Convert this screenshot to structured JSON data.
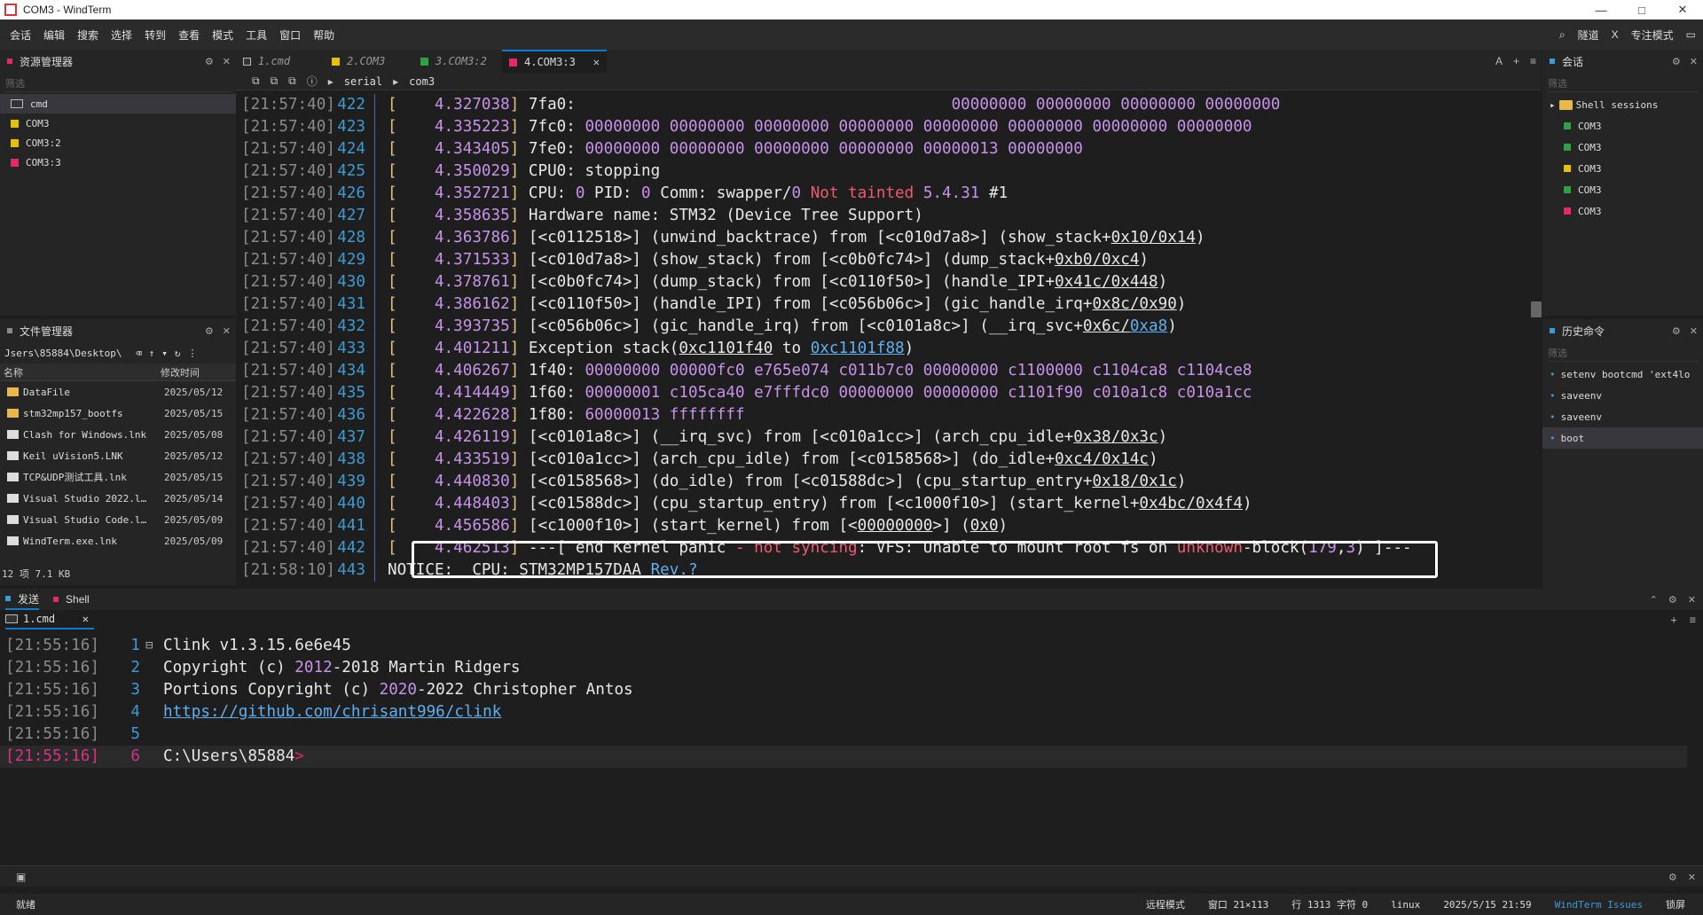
{
  "window": {
    "title": "COM3 - WindTerm",
    "controls": [
      "—",
      "□",
      "✕"
    ]
  },
  "menu": {
    "items": [
      "会话",
      "编辑",
      "搜索",
      "选择",
      "转到",
      "查看",
      "模式",
      "工具",
      "窗口",
      "帮助"
    ],
    "right": {
      "search": "⌕",
      "tunnel": "隧道",
      "x": "X",
      "focus_mode": "专注模式",
      "layout": "▭"
    }
  },
  "explorer": {
    "title": "资源管理器",
    "filter_placeholder": "筛选",
    "items": [
      {
        "label": "cmd",
        "color": ""
      },
      {
        "label": "COM3",
        "color": "#e5c100"
      },
      {
        "label": "COM3:2",
        "color": "#e5c100"
      },
      {
        "label": "COM3:3",
        "color": "#e5286c"
      }
    ]
  },
  "filemgr": {
    "title": "文件管理器",
    "path": "Jsers\\85884\\Desktop\\",
    "col_name": "名称",
    "col_modified": "修改时间",
    "files": [
      {
        "name": "DataFile",
        "date": "2025/05/12"
      },
      {
        "name": "stm32mp157_bootfs",
        "date": "2025/05/15"
      },
      {
        "name": "Clash for Windows.lnk",
        "date": "2025/05/08"
      },
      {
        "name": "Keil uVision5.LNK",
        "date": "2025/05/12"
      },
      {
        "name": "TCP&UDP测试工具.lnk",
        "date": "2025/05/15"
      },
      {
        "name": "Visual Studio 2022.l…",
        "date": "2025/05/14"
      },
      {
        "name": "Visual Studio Code.l…",
        "date": "2025/05/09"
      },
      {
        "name": "WindTerm.exe.lnk",
        "date": "2025/05/09"
      }
    ],
    "summary": "12 项 7.1 KB"
  },
  "tabs": [
    {
      "label": "1.cmd",
      "color": "#ffffff"
    },
    {
      "label": "2.COM3",
      "color": "#e5c100"
    },
    {
      "label": "3.COM3:2",
      "color": "#2ea043"
    },
    {
      "label": "4.COM3:3",
      "color": "#e5286c",
      "active": true,
      "close": "✕"
    }
  ],
  "breadcrumb": {
    "a": "serial",
    "b": "com3"
  },
  "terminal": {
    "lines": [
      {
        "ts": "[21:57:40]",
        "ln": "422",
        "html": "<span class='k-y'>[</span>    <span class='k-p'>4.327038</span><span class='k-y'>]</span> 7fa0:                                        <span class='k-p'>00000000 00000000 00000000 00000000</span>"
      },
      {
        "ts": "[21:57:40]",
        "ln": "423",
        "html": "<span class='k-y'>[</span>    <span class='k-p'>4.335223</span><span class='k-y'>]</span> 7fc0: <span class='k-p'>00000000 00000000 00000000 00000000 00000000 00000000 00000000 00000000</span>"
      },
      {
        "ts": "[21:57:40]",
        "ln": "424",
        "html": "<span class='k-y'>[</span>    <span class='k-p'>4.343405</span><span class='k-y'>]</span> 7fe0: <span class='k-p'>00000000 00000000 00000000 00000000 00000013 00000000</span>"
      },
      {
        "ts": "[21:57:40]",
        "ln": "425",
        "html": "<span class='k-y'>[</span>    <span class='k-p'>4.350029</span><span class='k-y'>]</span> CPU0: stopping"
      },
      {
        "ts": "[21:57:40]",
        "ln": "426",
        "html": "<span class='k-y'>[</span>    <span class='k-p'>4.352721</span><span class='k-y'>]</span> CPU: <span class='k-p'>0</span> PID: <span class='k-p'>0</span> Comm: swapper/<span class='k-p'>0</span> <span class='k-r'>Not tainted</span> <span class='k-p'>5.4.31</span> #1"
      },
      {
        "ts": "[21:57:40]",
        "ln": "427",
        "html": "<span class='k-y'>[</span>    <span class='k-p'>4.358635</span><span class='k-y'>]</span> Hardware name: STM32 (Device Tree Support)"
      },
      {
        "ts": "[21:57:40]",
        "ln": "428",
        "html": "<span class='k-y'>[</span>    <span class='k-p'>4.363786</span><span class='k-y'>]</span> [&lt;c0112518&gt;] (unwind_backtrace) from [&lt;c010d7a8&gt;] (show_stack+<span class='k-u'>0x10/0x14</span>)"
      },
      {
        "ts": "[21:57:40]",
        "ln": "429",
        "html": "<span class='k-y'>[</span>    <span class='k-p'>4.371533</span><span class='k-y'>]</span> [&lt;c010d7a8&gt;] (show_stack) from [&lt;c0b0fc74&gt;] (dump_stack+<span class='k-u'>0xb0/0xc4</span>)"
      },
      {
        "ts": "[21:57:40]",
        "ln": "430",
        "html": "<span class='k-y'>[</span>    <span class='k-p'>4.378761</span><span class='k-y'>]</span> [&lt;c0b0fc74&gt;] (dump_stack) from [&lt;c0110f50&gt;] (handle_IPI+<span class='k-u'>0x41c/0x448</span>)"
      },
      {
        "ts": "[21:57:40]",
        "ln": "431",
        "html": "<span class='k-y'>[</span>    <span class='k-p'>4.386162</span><span class='k-y'>]</span> [&lt;c0110f50&gt;] (handle_IPI) from [&lt;c056b06c&gt;] (gic_handle_irq+<span class='k-u'>0x8c/0x90</span>)"
      },
      {
        "ts": "[21:57:40]",
        "ln": "432",
        "html": "<span class='k-y'>[</span>    <span class='k-p'>4.393735</span><span class='k-y'>]</span> [&lt;c056b06c&gt;] (gic_handle_irq) from [&lt;c0101a8c&gt;] (__irq_svc+<span class='k-u'>0x6c/</span><span class='k-b'>0xa8</span>)"
      },
      {
        "ts": "[21:57:40]",
        "ln": "433",
        "html": "<span class='k-y'>[</span>    <span class='k-p'>4.401211</span><span class='k-y'>]</span> Exception stack(<span class='k-u'>0xc1101f40</span> to <span class='k-b'>0xc1101f88</span>)"
      },
      {
        "ts": "[21:57:40]",
        "ln": "434",
        "html": "<span class='k-y'>[</span>    <span class='k-p'>4.406267</span><span class='k-y'>]</span> 1f40: <span class='k-p'>00000000 00000fc0 e765e074 c011b7c0 00000000 c1100000 c1104ca8 c1104ce8</span>"
      },
      {
        "ts": "[21:57:40]",
        "ln": "435",
        "html": "<span class='k-y'>[</span>    <span class='k-p'>4.414449</span><span class='k-y'>]</span> 1f60: <span class='k-p'>00000001 c105ca40 e7fffdc0 00000000 00000000 c1101f90 c010a1c8 c010a1cc</span>"
      },
      {
        "ts": "[21:57:40]",
        "ln": "436",
        "html": "<span class='k-y'>[</span>    <span class='k-p'>4.422628</span><span class='k-y'>]</span> 1f80: <span class='k-p'>60000013 ffffffff</span>"
      },
      {
        "ts": "[21:57:40]",
        "ln": "437",
        "html": "<span class='k-y'>[</span>    <span class='k-p'>4.426119</span><span class='k-y'>]</span> [&lt;c0101a8c&gt;] (__irq_svc) from [&lt;c010a1cc&gt;] (arch_cpu_idle+<span class='k-u'>0x38/0x3c</span>)"
      },
      {
        "ts": "[21:57:40]",
        "ln": "438",
        "html": "<span class='k-y'>[</span>    <span class='k-p'>4.433519</span><span class='k-y'>]</span> [&lt;c010a1cc&gt;] (arch_cpu_idle) from [&lt;c0158568&gt;] (do_idle+<span class='k-u'>0xc4/0x14c</span>)"
      },
      {
        "ts": "[21:57:40]",
        "ln": "439",
        "html": "<span class='k-y'>[</span>    <span class='k-p'>4.440830</span><span class='k-y'>]</span> [&lt;c0158568&gt;] (do_idle) from [&lt;c01588dc&gt;] (cpu_startup_entry+<span class='k-u'>0x18/0x1c</span>)"
      },
      {
        "ts": "[21:57:40]",
        "ln": "440",
        "html": "<span class='k-y'>[</span>    <span class='k-p'>4.448403</span><span class='k-y'>]</span> [&lt;c01588dc&gt;] (cpu_startup_entry) from [&lt;c1000f10&gt;] (start_kernel+<span class='k-u'>0x4bc/0x4f4</span>)"
      },
      {
        "ts": "[21:57:40]",
        "ln": "441",
        "html": "<span class='k-y'>[</span>    <span class='k-p'>4.456586</span><span class='k-y'>]</span> [&lt;c1000f10&gt;] (start_kernel) from [&lt;<span class='k-u'>00000000</span>&gt;] (<span class='k-u'>0x0</span>)"
      },
      {
        "ts": "[21:57:40]",
        "ln": "442",
        "html": "<span class='k-y'>[</span>    <span class='k-p'>4.462513</span><span class='k-y'>]</span> ---[ end Kernel panic <span class='k-r'>-</span> <span class='k-r'>not syncing</span>: VFS: Unable to mount root fs on <span class='k-r'>unknown</span>-block(<span class='k-p'>179</span>,<span class='k-p'>3</span>) ]---"
      },
      {
        "ts": "[21:58:10]",
        "ln": "443",
        "html": "NOTICE:  CPU: STM32MP157DAA <span class='k-b'>Rev.?</span>"
      }
    ]
  },
  "sessions": {
    "title": "会话",
    "filter_placeholder": "筛选",
    "group": "Shell sessions",
    "items": [
      {
        "label": "COM3",
        "color": "#2ea043"
      },
      {
        "label": "COM3",
        "color": "#2ea043"
      },
      {
        "label": "COM3",
        "color": "#e5c100"
      },
      {
        "label": "COM3",
        "color": "#2ea043"
      },
      {
        "label": "COM3",
        "color": "#e5286c"
      }
    ]
  },
  "history": {
    "title": "历史命令",
    "filter_placeholder": "筛选",
    "items": [
      "setenv bootcmd 'ext4lo",
      "saveenv",
      "saveenv",
      "boot"
    ]
  },
  "bottom": {
    "tab_send": "发送",
    "tab_shell": "Shell",
    "subtab": "1.cmd",
    "subtab_close": "✕",
    "lines": [
      {
        "ts": "[21:55:16]",
        "ln": "1",
        "html": "Clink v1.3.15.6e6e45"
      },
      {
        "ts": "[21:55:16]",
        "ln": "2",
        "html": "Copyright (c) <span class='num'>2012</span>-2018 Martin Ridgers"
      },
      {
        "ts": "[21:55:16]",
        "ln": "3",
        "html": "Portions Copyright (c) <span class='num'>2020</span>-2022 Christopher Antos"
      },
      {
        "ts": "[21:55:16]",
        "ln": "4",
        "html": "<span class='url'>https://github.com/chrisant996/clink</span>"
      },
      {
        "ts": "[21:55:16]",
        "ln": "5",
        "html": ""
      },
      {
        "ts": "[21:55:16]",
        "ln": "6",
        "html": "C:\\Users\\85884<span style='color:#e5286c'>&gt;</span>",
        "current": true
      }
    ]
  },
  "statusbar": {
    "ready": "就绪",
    "remote_mode": "远程模式",
    "window_size": "窗口 21×113",
    "position": "行 1313 字符 0",
    "os": "linux",
    "datetime": "2025/5/15 21:59",
    "issues": "WindTerm Issues",
    "lock": "锁屏"
  }
}
